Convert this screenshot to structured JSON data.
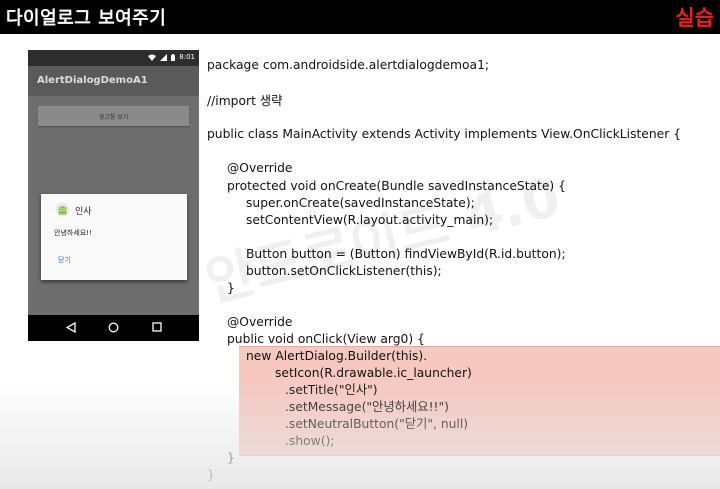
{
  "header": {
    "title": "다이얼로그 보여주기",
    "badge": "실습"
  },
  "phone": {
    "status_time": "8:01",
    "app_title": "AlertDialogDemoA1",
    "button_label": "경고창 보기",
    "dialog": {
      "title": "인사",
      "message": "안녕하세요!!",
      "neutral_button": "닫기"
    }
  },
  "watermark": "안드로이드 4.0",
  "code_lines": [
    "package com.androidside.alertdialogdemoa1;",
    "//import 생략",
    "public class MainActivity extends Activity implements View.OnClickListener {",
    "@Override",
    "protected void onCreate(Bundle savedInstanceState) {",
    "super.onCreate(savedInstanceState);",
    "setContentView(R.layout.activity_main);",
    "Button button = (Button) findViewById(R.id.button);",
    "button.setOnClickListener(this);",
    "}",
    "@Override",
    "public void onClick(View arg0) {",
    "new AlertDialog.Builder(this).",
    "setIcon(R.drawable.ic_launcher)",
    ".setTitle(\"인사\")",
    ".setMessage(\"안녕하세요!!\")",
    ".setNeutralButton(\"닫기\", null)",
    ".show();",
    "}",
    "}"
  ],
  "colors": {
    "badge": "#e8231d",
    "highlight": "#f6c8c0",
    "dialog_button": "#1a7fb5"
  }
}
